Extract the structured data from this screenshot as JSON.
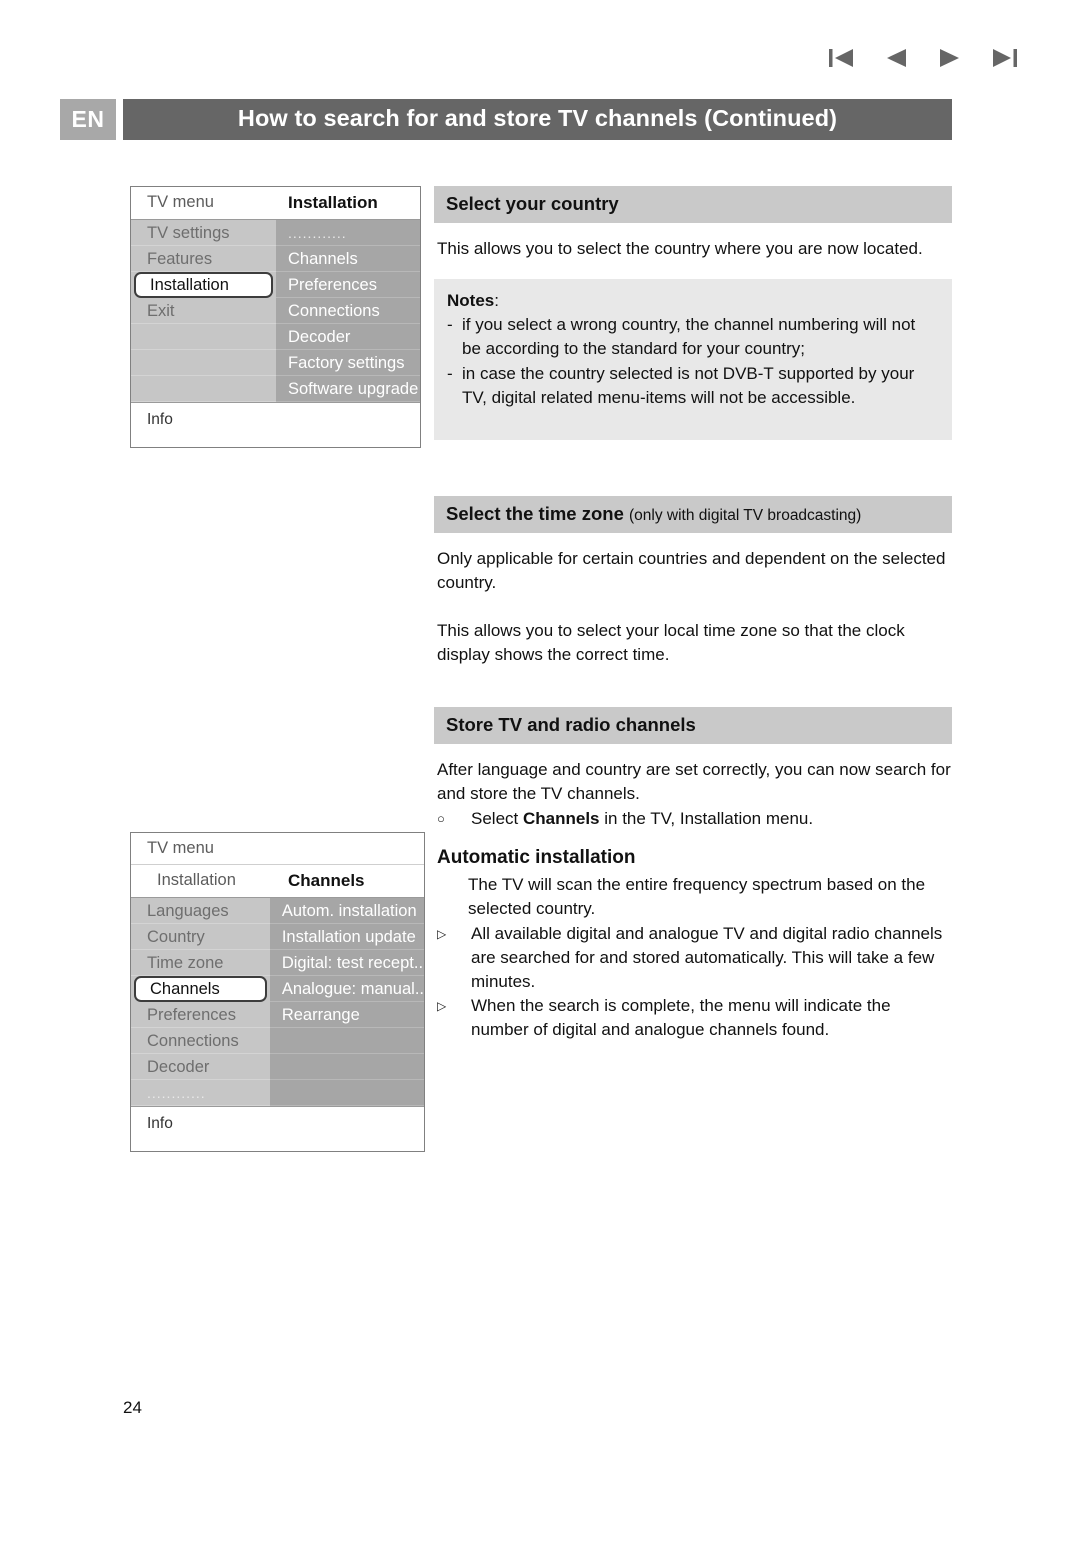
{
  "header": {
    "language_badge": "EN",
    "title": "How to search for and store TV channels  (Continued)",
    "nav_icons": [
      "skip-back-icon",
      "previous-icon",
      "next-icon",
      "skip-forward-icon"
    ],
    "colors": {
      "badge_bg": "#a8a8a8",
      "bar_bg": "#666666",
      "section_bar_bg": "#c9c9c9",
      "notes_bg": "#e8e8e8",
      "menu_left_bg": "#c6c6c6",
      "menu_right_bg": "#a6a6a6"
    }
  },
  "menu_installation": {
    "head_left": "TV menu",
    "head_right": "Installation",
    "left_items": [
      {
        "label": "TV settings",
        "selected": false,
        "dots": false
      },
      {
        "label": "Features",
        "selected": false,
        "dots": false
      },
      {
        "label": "Installation",
        "selected": true,
        "dots": false
      },
      {
        "label": "Exit",
        "selected": false,
        "dots": false
      },
      {
        "label": "",
        "selected": false,
        "dots": false
      },
      {
        "label": "",
        "selected": false,
        "dots": false
      },
      {
        "label": "",
        "selected": false,
        "dots": false
      }
    ],
    "right_items": [
      {
        "label": "............",
        "dots": true
      },
      {
        "label": "Channels",
        "dots": false
      },
      {
        "label": "Preferences",
        "dots": false
      },
      {
        "label": "Connections",
        "dots": false
      },
      {
        "label": "Decoder",
        "dots": false
      },
      {
        "label": "Factory settings",
        "dots": false
      },
      {
        "label": "Software upgrade",
        "dots": false
      }
    ],
    "footer": "Info"
  },
  "menu_channels": {
    "head_top": "TV menu",
    "head_left": "Installation",
    "head_right": "Channels",
    "left_items": [
      {
        "label": "Languages",
        "selected": false,
        "dots": false
      },
      {
        "label": "Country",
        "selected": false,
        "dots": false
      },
      {
        "label": "Time zone",
        "selected": false,
        "dots": false
      },
      {
        "label": "Channels",
        "selected": true,
        "dots": false
      },
      {
        "label": "Preferences",
        "selected": false,
        "dots": false
      },
      {
        "label": "Connections",
        "selected": false,
        "dots": false
      },
      {
        "label": "Decoder",
        "selected": false,
        "dots": false
      },
      {
        "label": "............",
        "selected": false,
        "dots": true
      }
    ],
    "right_items": [
      {
        "label": "Autom. installation"
      },
      {
        "label": "Installation update"
      },
      {
        "label": "Digital: test recept.."
      },
      {
        "label": "Analogue: manual.."
      },
      {
        "label": "Rearrange"
      },
      {
        "label": ""
      },
      {
        "label": ""
      },
      {
        "label": ""
      }
    ],
    "footer": "Info"
  },
  "sections": {
    "country": {
      "heading": "Select your country",
      "body": "This allows you to select the country where you are now located.",
      "notes_label": "Notes",
      "notes_colon": ":",
      "notes": [
        "if you select a wrong country, the channel numbering will not be according to the standard for your country;",
        "in case the country selected is not DVB-T supported by your TV, digital related menu-items will not be accessible."
      ],
      "note_dash": "-"
    },
    "timezone": {
      "heading": "Select the time zone",
      "heading_sub": "(only with digital TV broadcasting)",
      "body1": "Only applicable for certain countries and dependent on the selected country.",
      "body2": "This allows you to select your local time zone so that the clock display shows the correct time."
    },
    "store": {
      "heading": "Store TV and radio channels",
      "body": "After language and country are set correctly, you can now search for and store the TV channels.",
      "bullet_mark": "○",
      "bullet": {
        "pre": "Select ",
        "bold": "Channels",
        "post": " in the TV, Installation menu."
      },
      "sub_heading": "Automatic installation",
      "sub_body": "The TV will scan the entire frequency spectrum based on the selected country.",
      "tri_mark": "▷",
      "tri_items": [
        "All available digital and analogue TV and digital radio channels are searched for and stored automatically. This will take a few minutes.",
        "When the search is complete, the menu will indicate the number of digital and analogue channels found."
      ]
    }
  },
  "page_number": "24"
}
